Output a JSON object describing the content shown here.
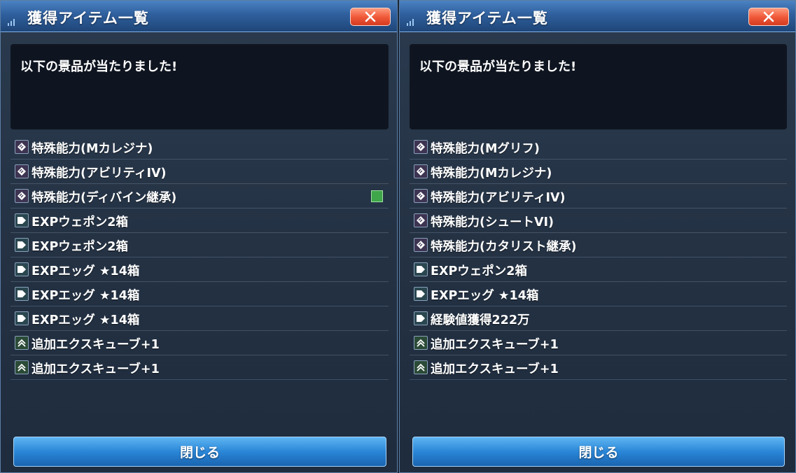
{
  "panels": [
    {
      "title": "獲得アイテム一覧",
      "message": "以下の景品が当たりました!",
      "close_label": "閉じる",
      "items": [
        {
          "label": "特殊能力(Mカレジナ)",
          "icon": "ability-icon",
          "tag": false
        },
        {
          "label": "特殊能力(アビリティIV)",
          "icon": "ability-icon",
          "tag": false
        },
        {
          "label": "特殊能力(ディバイン継承)",
          "icon": "ability-icon",
          "tag": true
        },
        {
          "label": "EXPウェポン2箱",
          "icon": "exp-item-icon",
          "tag": false
        },
        {
          "label": "EXPウェポン2箱",
          "icon": "exp-item-icon",
          "tag": false
        },
        {
          "label": "EXPエッグ ★14箱",
          "icon": "exp-item-icon",
          "tag": false
        },
        {
          "label": "EXPエッグ ★14箱",
          "icon": "exp-item-icon",
          "tag": false
        },
        {
          "label": "EXPエッグ ★14箱",
          "icon": "exp-item-icon",
          "tag": false
        },
        {
          "label": "追加エクスキューブ+1",
          "icon": "ex-cube-icon",
          "tag": false
        },
        {
          "label": "追加エクスキューブ+1",
          "icon": "ex-cube-icon",
          "tag": false
        }
      ]
    },
    {
      "title": "獲得アイテム一覧",
      "message": "以下の景品が当たりました!",
      "close_label": "閉じる",
      "items": [
        {
          "label": "特殊能力(Mグリフ)",
          "icon": "ability-icon",
          "tag": false
        },
        {
          "label": "特殊能力(Mカレジナ)",
          "icon": "ability-icon",
          "tag": false
        },
        {
          "label": "特殊能力(アビリティIV)",
          "icon": "ability-icon",
          "tag": false
        },
        {
          "label": "特殊能力(シュートVI)",
          "icon": "ability-icon",
          "tag": false
        },
        {
          "label": "特殊能力(カタリスト継承)",
          "icon": "ability-icon",
          "tag": false
        },
        {
          "label": "EXPウェポン2箱",
          "icon": "exp-item-icon",
          "tag": false
        },
        {
          "label": "EXPエッグ ★14箱",
          "icon": "exp-item-icon",
          "tag": false
        },
        {
          "label": "経験値獲得222万",
          "icon": "exp-item-icon",
          "tag": false
        },
        {
          "label": "追加エクスキューブ+1",
          "icon": "ex-cube-icon",
          "tag": false
        },
        {
          "label": "追加エクスキューブ+1",
          "icon": "ex-cube-icon",
          "tag": false
        }
      ]
    }
  ],
  "colors": {
    "title_bar": "#2f5f9d",
    "close_x": "#f05b3b",
    "close_button": "#2a86d7",
    "message_box": "#0f1520",
    "new_tag": "#3fa64a"
  }
}
